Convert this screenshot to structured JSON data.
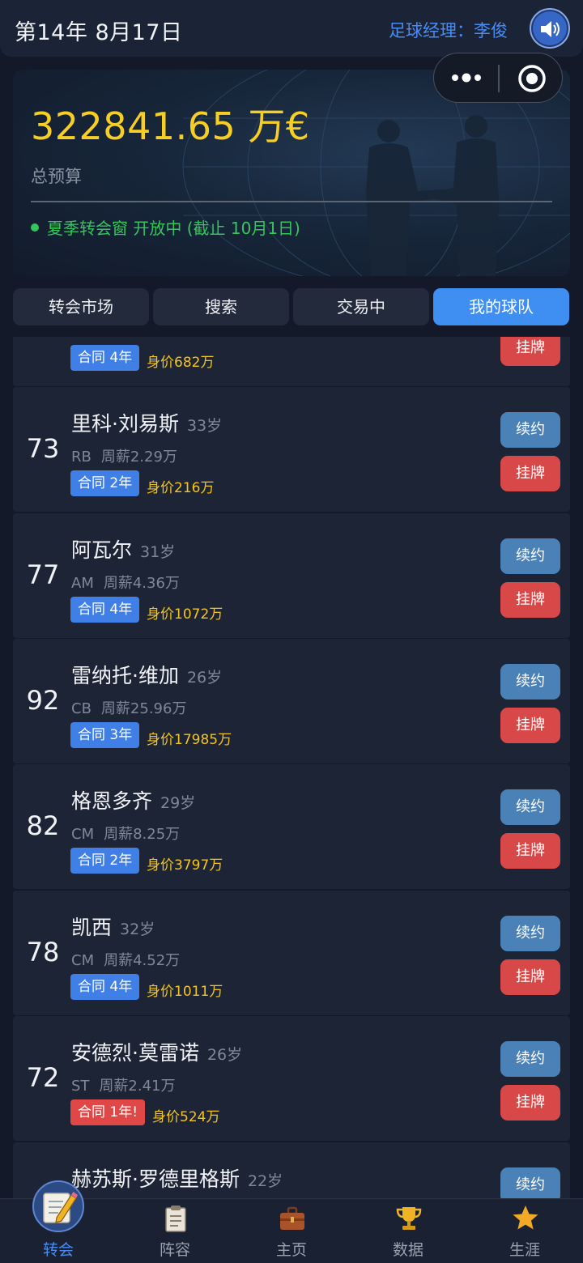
{
  "header": {
    "date": "第14年 8月17日",
    "manager_label": "足球经理：李俊",
    "sound_icon": "speaker-icon"
  },
  "budget": {
    "amount": "322841.65 万€",
    "label": "总预算",
    "window_status": "夏季转会窗 开放中 (截止 10月1日)"
  },
  "tabs": [
    {
      "label": "转会市场",
      "active": false
    },
    {
      "label": "搜索",
      "active": false
    },
    {
      "label": "交易中",
      "active": false
    },
    {
      "label": "我的球队",
      "active": true
    }
  ],
  "actions": {
    "renew": "续约",
    "list": "挂牌"
  },
  "partial_top": {
    "contract": "合同 4年",
    "value": "身价682万"
  },
  "players": [
    {
      "rating": "73",
      "name": "里科·刘易斯",
      "age": "33岁",
      "position": "RB",
      "wage": "周薪2.29万",
      "contract": "合同 2年",
      "value": "身价216万",
      "urgent": false
    },
    {
      "rating": "77",
      "name": "阿瓦尔",
      "age": "31岁",
      "position": "AM",
      "wage": "周薪4.36万",
      "contract": "合同 4年",
      "value": "身价1072万",
      "urgent": false
    },
    {
      "rating": "92",
      "name": "雷纳托·维加",
      "age": "26岁",
      "position": "CB",
      "wage": "周薪25.96万",
      "contract": "合同 3年",
      "value": "身价17985万",
      "urgent": false
    },
    {
      "rating": "82",
      "name": "格恩多齐",
      "age": "29岁",
      "position": "CM",
      "wage": "周薪8.25万",
      "contract": "合同 2年",
      "value": "身价3797万",
      "urgent": false
    },
    {
      "rating": "78",
      "name": "凯西",
      "age": "32岁",
      "position": "CM",
      "wage": "周薪4.52万",
      "contract": "合同 4年",
      "value": "身价1011万",
      "urgent": false
    },
    {
      "rating": "72",
      "name": "安德烈·莫雷诺",
      "age": "26岁",
      "position": "ST",
      "wage": "周薪2.41万",
      "contract": "合同 1年!",
      "value": "身价524万",
      "urgent": true
    }
  ],
  "partial_bottom": {
    "name": "赫苏斯·罗德里格斯",
    "age": "22岁"
  },
  "bottom_nav": [
    {
      "label": "转会",
      "icon": "pencil-note-icon",
      "active": true
    },
    {
      "label": "阵容",
      "icon": "clipboard-icon",
      "active": false
    },
    {
      "label": "主页",
      "icon": "briefcase-icon",
      "active": false
    },
    {
      "label": "数据",
      "icon": "trophy-icon",
      "active": false
    },
    {
      "label": "生涯",
      "icon": "star-icon",
      "active": false
    }
  ],
  "colors": {
    "accent": "#3f8ef1",
    "gold": "#f7cf24",
    "green": "#36c55c",
    "danger": "#d94848",
    "renew": "#4a82b8"
  }
}
